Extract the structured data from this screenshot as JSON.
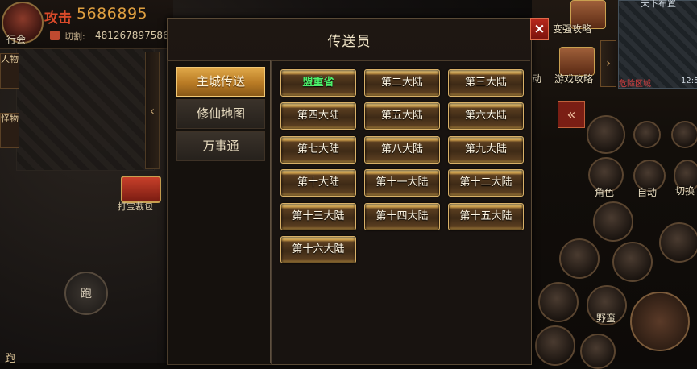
{
  "hud": {
    "guild_label": "行会",
    "attack_label": "攻击",
    "attack_value": "5686895",
    "cut_label": "切割:",
    "cut_value": "481267897586"
  },
  "left_side": {
    "character_label": "人物",
    "monster_label": "怪物",
    "chest_label": "打宝裁包",
    "run_label": "跑",
    "run_label_bottom": "跑"
  },
  "right_side": {
    "map_title": "天下布置",
    "strengthen_label": "变强攻略",
    "game_guide_label": "游戏攻略",
    "activity_label": "动",
    "danger_zone_label": "危险区域",
    "clock": "12:5",
    "character_btn_label": "角色",
    "auto_btn_label": "自动",
    "switch_btn_label": "切换",
    "wild_btn_label": "野蛮"
  },
  "dialog": {
    "title": "传送员",
    "close": "×",
    "categories": [
      "主城传送",
      "修仙地图",
      "万事通"
    ],
    "active_category": "主城传送",
    "destinations": [
      "盟重省",
      "第二大陆",
      "第三大陆",
      "第四大陆",
      "第五大陆",
      "第六大陆",
      "第七大陆",
      "第八大陆",
      "第九大陆",
      "第十大陆",
      "第十一大陆",
      "第十二大陆",
      "第十三大陆",
      "第十四大陆",
      "第十五大陆",
      "第十六大陆"
    ],
    "highlight_color": "#4cf06a"
  }
}
